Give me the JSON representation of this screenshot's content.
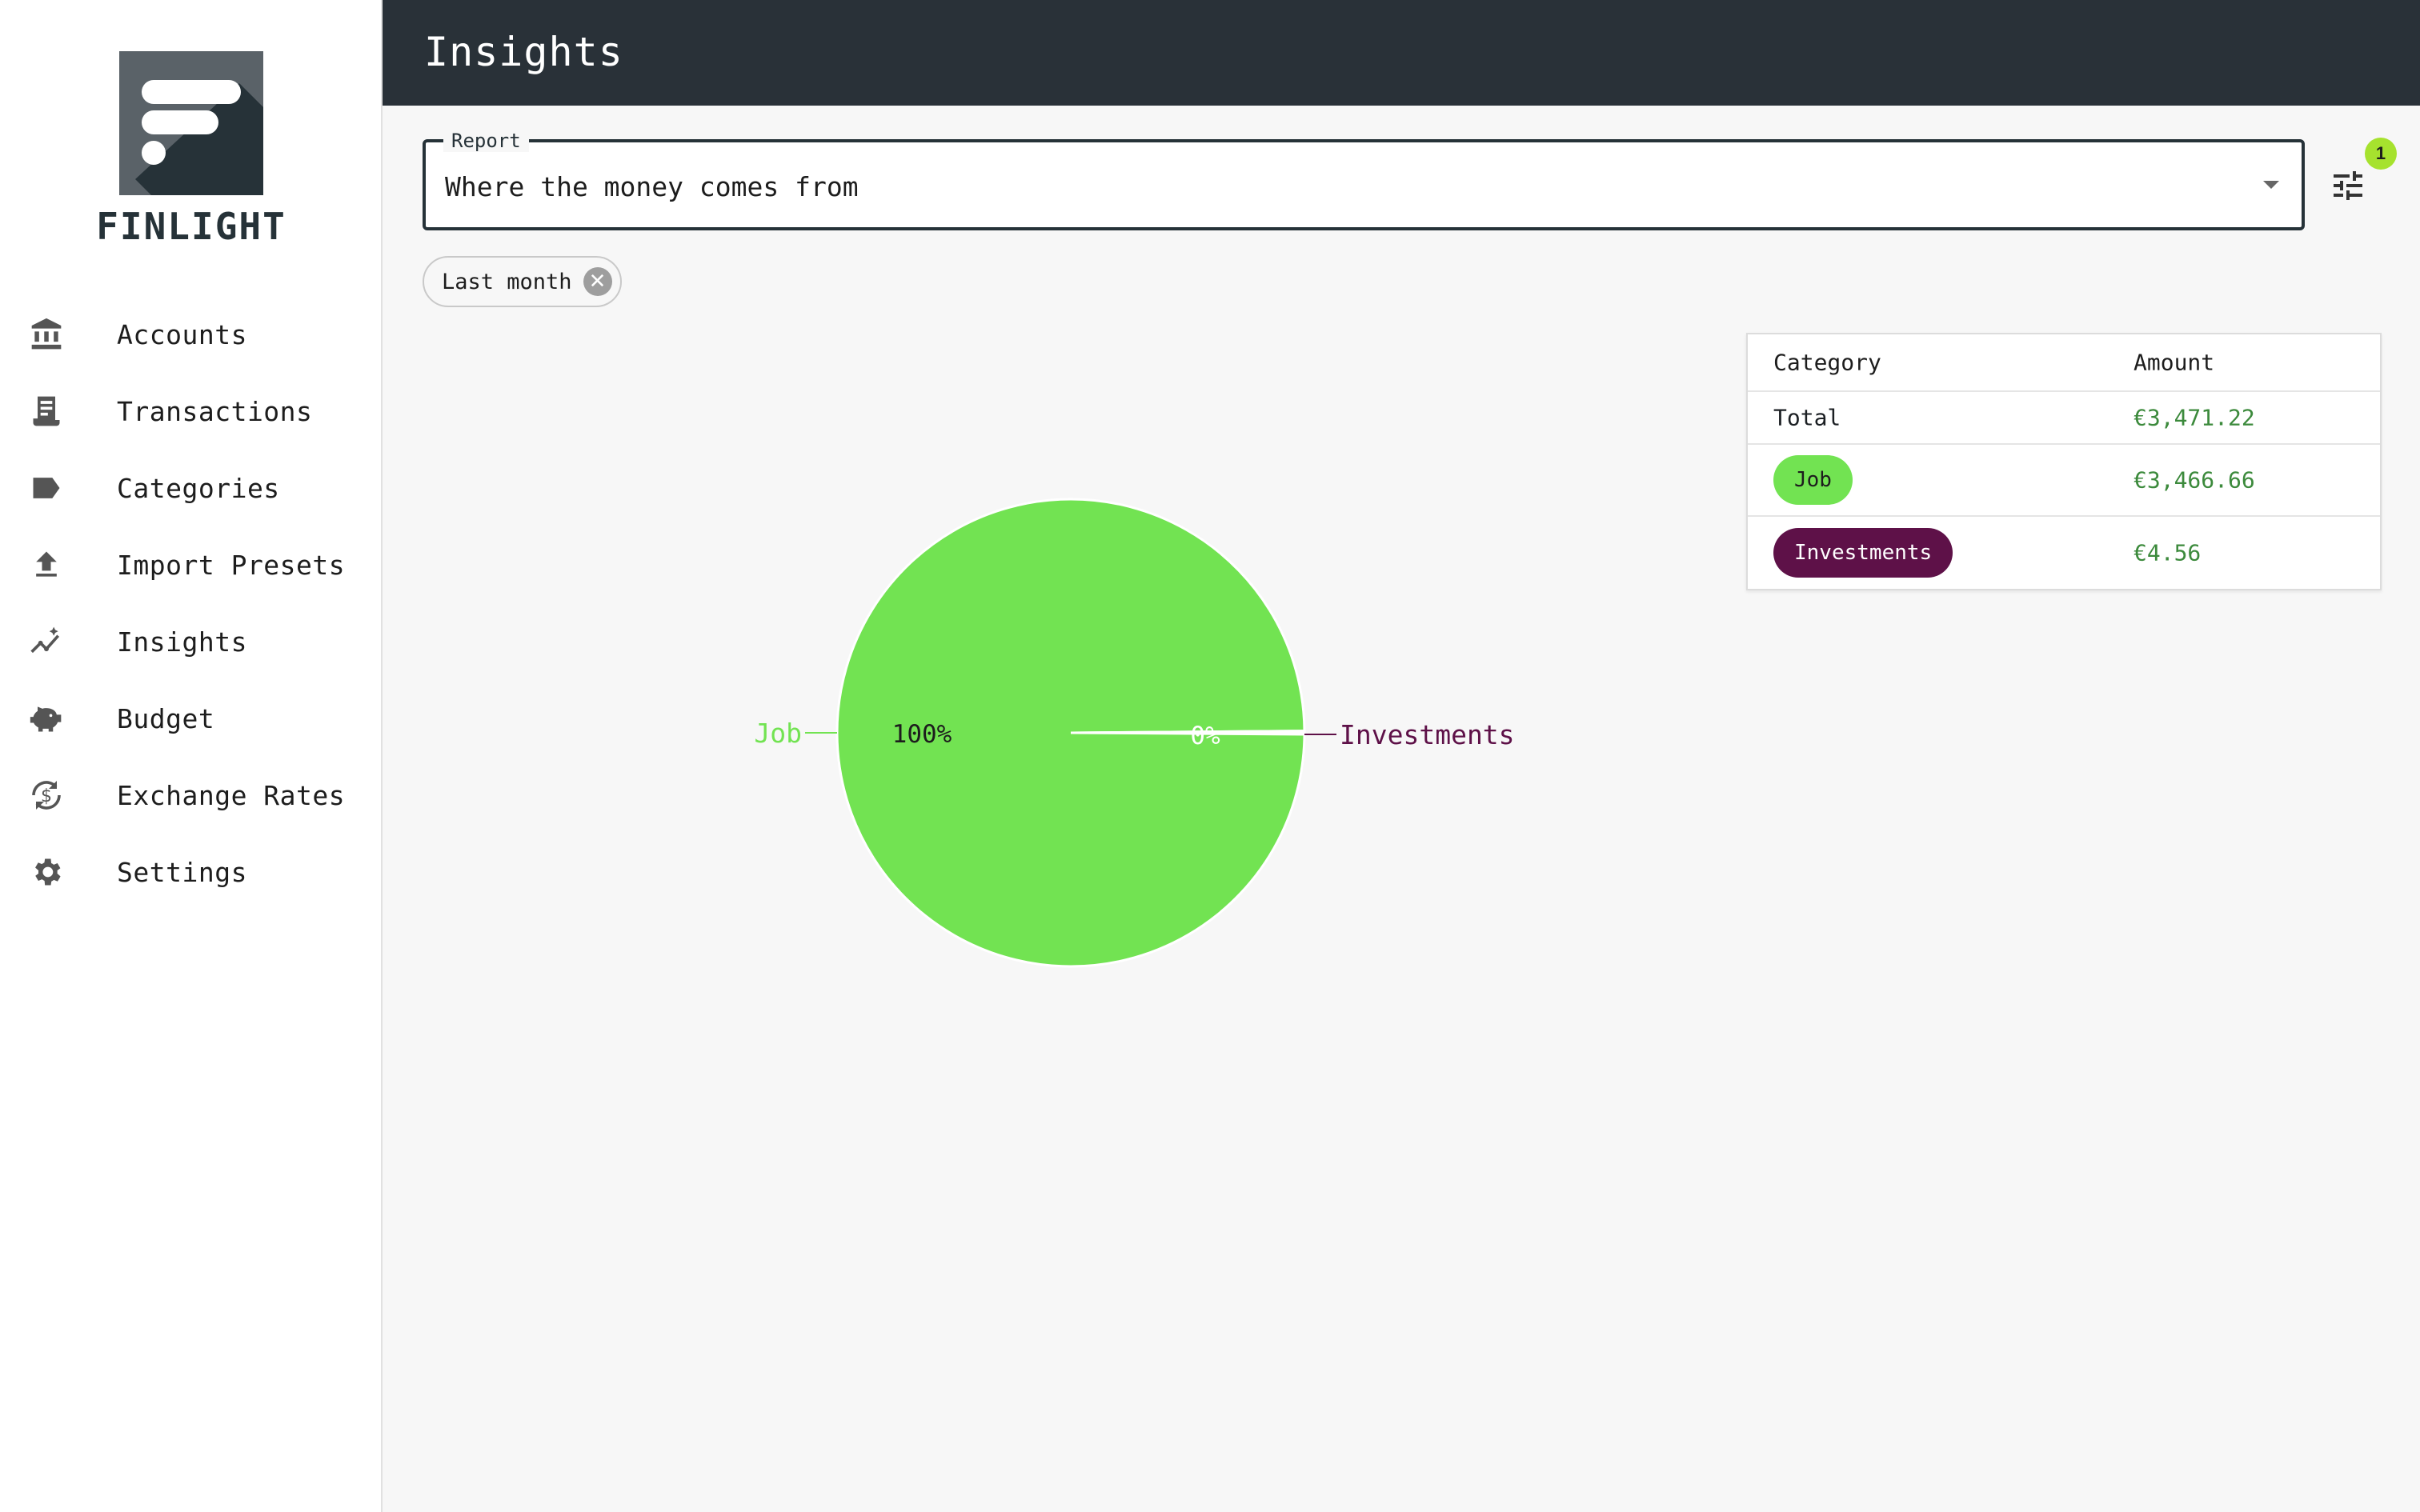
{
  "app": {
    "brand": "FINLIGHT",
    "page_title": "Insights"
  },
  "sidebar": {
    "items": [
      {
        "label": "Accounts",
        "icon": "bank-icon"
      },
      {
        "label": "Transactions",
        "icon": "receipt-icon"
      },
      {
        "label": "Categories",
        "icon": "label-icon"
      },
      {
        "label": "Import Presets",
        "icon": "upload-icon"
      },
      {
        "label": "Insights",
        "icon": "insights-icon"
      },
      {
        "label": "Budget",
        "icon": "piggy-bank-icon"
      },
      {
        "label": "Exchange Rates",
        "icon": "currency-exchange-icon"
      },
      {
        "label": "Settings",
        "icon": "gear-icon"
      }
    ]
  },
  "report": {
    "label": "Report",
    "value": "Where the money comes from"
  },
  "filters": {
    "badge_count": "1",
    "chips": [
      {
        "label": "Last month"
      }
    ]
  },
  "table": {
    "headers": {
      "category": "Category",
      "amount": "Amount"
    },
    "total": {
      "label": "Total",
      "amount": "€3,471.22"
    },
    "rows": [
      {
        "category": "Job",
        "amount": "€3,466.66",
        "color": "#72e352",
        "text_color": "#1d1d1d"
      },
      {
        "category": "Investments",
        "amount": "€4.56",
        "color": "#5e1148",
        "text_color": "#ffffff"
      }
    ]
  },
  "colors": {
    "header_bg": "#293138",
    "amount_text": "#3c8a3c",
    "badge": "#a6e22e"
  },
  "chart_data": {
    "type": "pie",
    "categories": [
      "Job",
      "Investments"
    ],
    "values": [
      3466.66,
      4.56
    ],
    "percent_labels": [
      "100%",
      "0%"
    ],
    "colors": [
      "#72e352",
      "#5e1148"
    ]
  }
}
